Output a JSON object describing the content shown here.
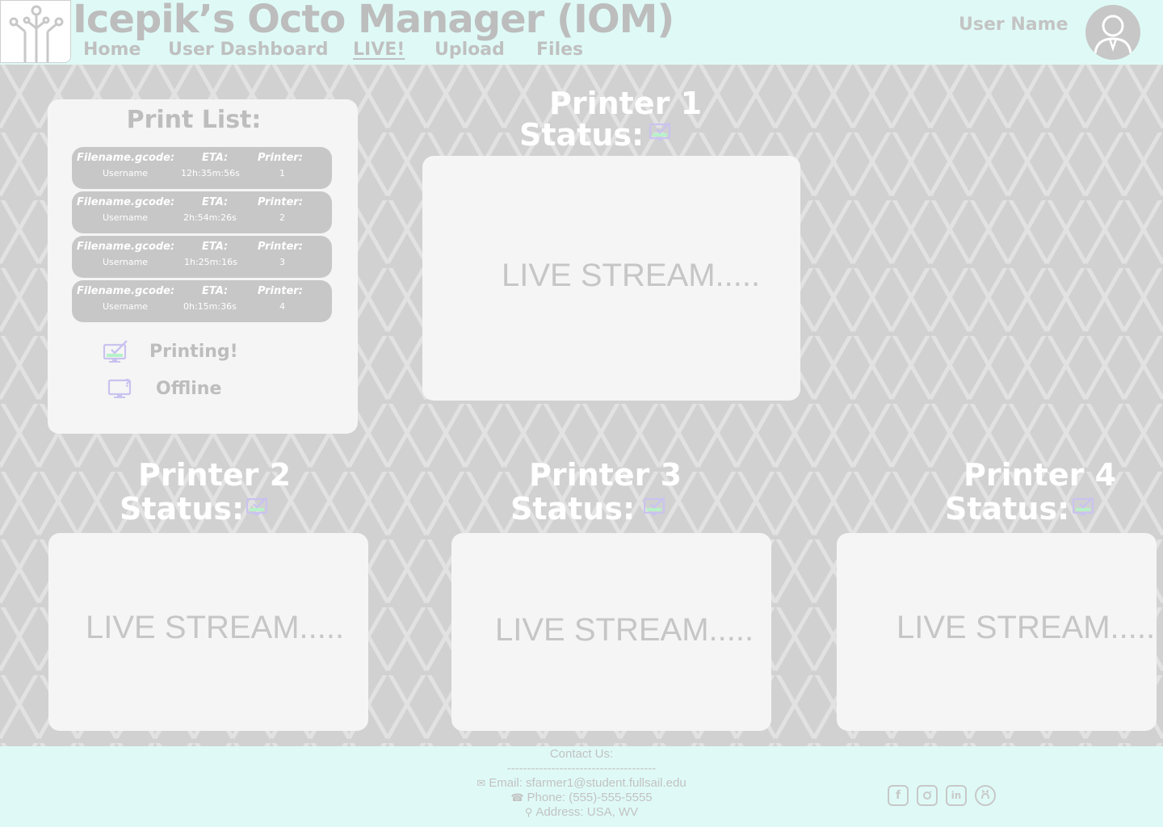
{
  "header": {
    "title": "Icepik’s Octo Manager (IOM)",
    "nav": [
      {
        "label": "Home",
        "active": false
      },
      {
        "label": "User Dashboard",
        "active": false
      },
      {
        "label": "LIVE!",
        "active": true
      },
      {
        "label": "Upload",
        "active": false
      },
      {
        "label": "Files",
        "active": false
      }
    ],
    "user_name": "User Name"
  },
  "print_list": {
    "title": "Print List:",
    "headers": {
      "file": "Filename.gcode:",
      "eta": "ETA:",
      "printer": "Printer:"
    },
    "jobs": [
      {
        "user": "Username",
        "eta": "12h:35m:56s",
        "printer": "1"
      },
      {
        "user": "Username",
        "eta": "2h:54m:26s",
        "printer": "2"
      },
      {
        "user": "Username",
        "eta": "1h:25m:16s",
        "printer": "3"
      },
      {
        "user": "Username",
        "eta": "0h:15m:36s",
        "printer": "4"
      }
    ],
    "legend": [
      {
        "label": "Printing!",
        "icon": "monitor-check-icon"
      },
      {
        "label": "Offline",
        "icon": "monitor-question-icon"
      }
    ]
  },
  "printers": [
    {
      "title": "Printer 1",
      "status_label": "Status:",
      "stream_text": "LIVE STREAM....."
    },
    {
      "title": "Printer 2",
      "status_label": "Status:",
      "stream_text": "LIVE STREAM....."
    },
    {
      "title": "Printer 3",
      "status_label": "Status:",
      "stream_text": "LIVE STREAM....."
    },
    {
      "title": "Printer 4",
      "status_label": "Status:",
      "stream_text": "LIVE STREAM....."
    }
  ],
  "footer": {
    "contact_title": "Contact Us:",
    "divider": "-------------------------------------",
    "email": "Email: sfarmer1@student.fullsail.edu",
    "phone": "Phone: (555)-555-5555",
    "address": "Address: USA, WV",
    "social": [
      "facebook-icon",
      "instagram-icon",
      "linkedin-icon",
      "github-icon"
    ]
  },
  "colors": {
    "header_bg": "#dffaf6",
    "page_bg": "#d4d4d4",
    "panel_bg": "#f5f5f5",
    "job_bg": "#c7c7c7",
    "icon_accent": "#c9c3f0"
  }
}
